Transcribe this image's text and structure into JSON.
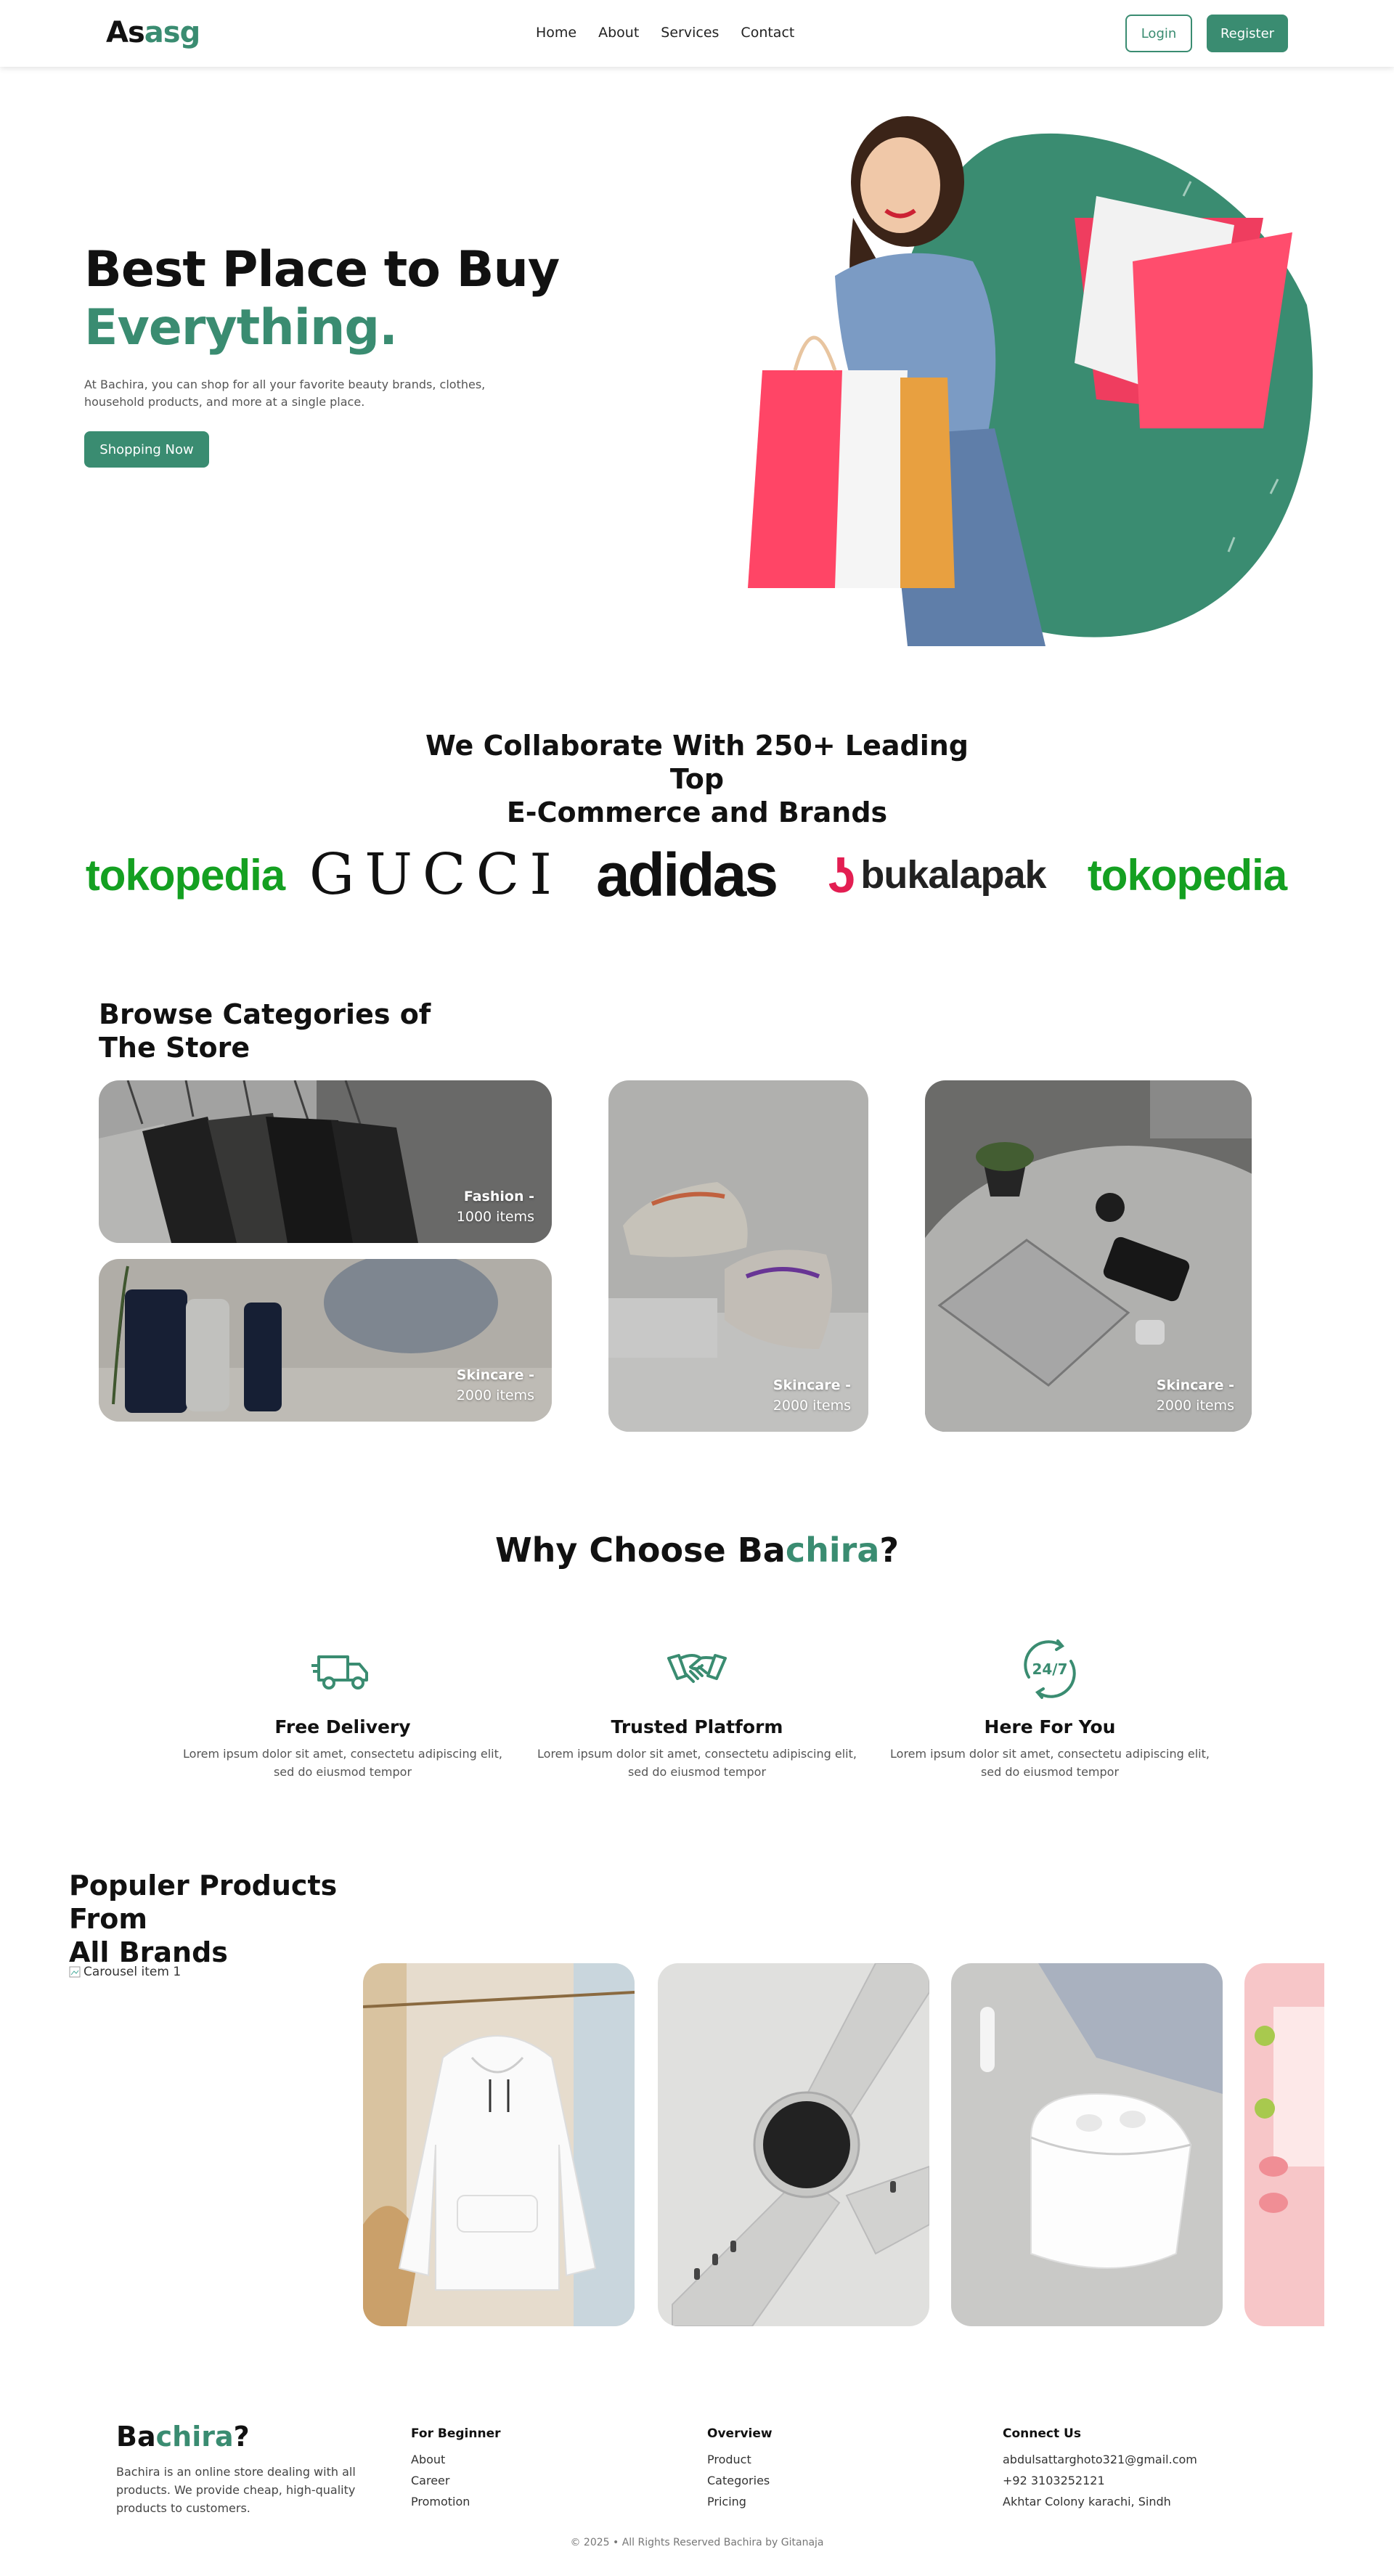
{
  "nav": {
    "logo_part1": "As",
    "logo_part2": "asg",
    "links": [
      "Home",
      "About",
      "Services",
      "Contact"
    ],
    "login": "Login",
    "register": "Register"
  },
  "hero": {
    "title_line1": "Best Place to Buy",
    "title_line2": "Everything.",
    "description": "At Bachira, you can shop for all your favorite beauty brands, clothes, household products, and more at a single place.",
    "cta": "Shopping Now"
  },
  "collab": {
    "title_line1": "We Collaborate With 250+ Leading Top",
    "title_line2": "E-Commerce and Brands",
    "brands": [
      "tokopedia",
      "GUCCI",
      "adidas",
      "bukalapak",
      "tokopedia"
    ]
  },
  "categories": {
    "title_line1": "Browse Categories of",
    "title_line2": "The Store",
    "items": [
      {
        "name": "Fashion -",
        "count": "1000 items"
      },
      {
        "name": "Skincare -",
        "count": "2000 items"
      },
      {
        "name": "Skincare -",
        "count": "2000 items"
      },
      {
        "name": "Skincare -",
        "count": "2000 items"
      }
    ]
  },
  "why": {
    "title_part1": "Why Choose Ba",
    "title_part2": "chira",
    "title_part3": "?",
    "features": [
      {
        "icon": "delivery-truck-icon",
        "title": "Free Delivery",
        "desc": "Lorem ipsum dolor sit amet, consectetu adipiscing elit, sed do eiusmod tempor"
      },
      {
        "icon": "handshake-icon",
        "title": "Trusted Platform",
        "desc": "Lorem ipsum dolor sit amet, consectetu adipiscing elit, sed do eiusmod tempor"
      },
      {
        "icon": "support-24-7-icon",
        "title": "Here For You",
        "desc": "Lorem ipsum dolor sit amet, consectetu adipiscing elit, sed do eiusmod tempor"
      }
    ],
    "badge_247": "24/7"
  },
  "products": {
    "title_line1": "Populer Products From",
    "title_line2": "All Brands",
    "carousel_alt": "Carousel item 1"
  },
  "footer": {
    "logo_part1": "Ba",
    "logo_part2": "chira",
    "logo_part3": "?",
    "description": "Bachira is an online store dealing with all products. We provide cheap, high-quality products to customers.",
    "col1": {
      "heading": "For Beginner",
      "links": [
        "About",
        "Career",
        "Promotion"
      ]
    },
    "col2": {
      "heading": "Overview",
      "links": [
        "Product",
        "Categories",
        "Pricing"
      ]
    },
    "col3": {
      "heading": "Connect Us",
      "links": [
        "abdulsattarghoto321@gmail.com",
        "+92 3103252121",
        "Akhtar Colony karachi, Sindh"
      ]
    },
    "copyright": "© 2025 • All Rights Reserved Bachira by Gitanaja"
  },
  "colors": {
    "accent": "#3a8c71",
    "tokopedia": "#14a021",
    "bukalapak": "#e31e52"
  }
}
